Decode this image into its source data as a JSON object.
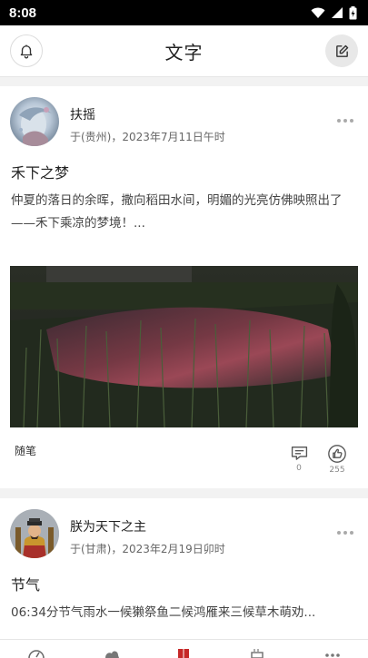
{
  "status_bar": {
    "time": "8:08"
  },
  "header": {
    "title": "文字"
  },
  "posts": [
    {
      "author": "扶摇",
      "meta": "于(贵州)，2023年7月11日午时",
      "title": "禾下之梦",
      "excerpt": "仲夏的落日的余晖，撒向稻田水间，明媚的光亮仿佛映照出了——禾下乘凉的梦境！...",
      "tag": "随笔",
      "comments": "0",
      "likes": "255"
    },
    {
      "author": "朕为天下之主",
      "meta": "于(甘肃)，2023年2月19日卯时",
      "title": "节气",
      "excerpt": "06:34分节气雨水一候獭祭鱼二候鸿雁来三候草木萌劝..."
    }
  ],
  "icons": {
    "bell": "bell-icon",
    "edit": "edit-icon",
    "more": "more-horizontal-icon",
    "comment": "comment-icon",
    "like": "thumbs-up-icon"
  },
  "colors": {
    "accent": "#c62828"
  }
}
